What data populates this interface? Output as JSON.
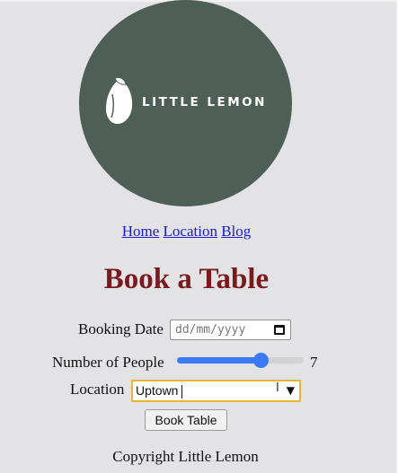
{
  "brand": {
    "logo_text": "LITTLE LEMON",
    "circle_color": "#4e5f57"
  },
  "nav": {
    "items": [
      {
        "label": "Home"
      },
      {
        "label": "Location"
      },
      {
        "label": "Blog"
      }
    ]
  },
  "page": {
    "title": "Book a Table"
  },
  "form": {
    "booking_date": {
      "label": "Booking Date",
      "placeholder": "dd/mm/yyyy"
    },
    "people": {
      "label": "Number of People",
      "value": "7",
      "slider_fraction": 0.66
    },
    "location": {
      "label": "Location",
      "selected": "Uptown"
    },
    "submit_label": "Book Table"
  },
  "footer": {
    "text": "Copyright Little Lemon"
  },
  "colors": {
    "title": "#7a1a1e",
    "link": "#1b1bd0",
    "accent": "#3c79f6",
    "focus": "#e8b537"
  }
}
